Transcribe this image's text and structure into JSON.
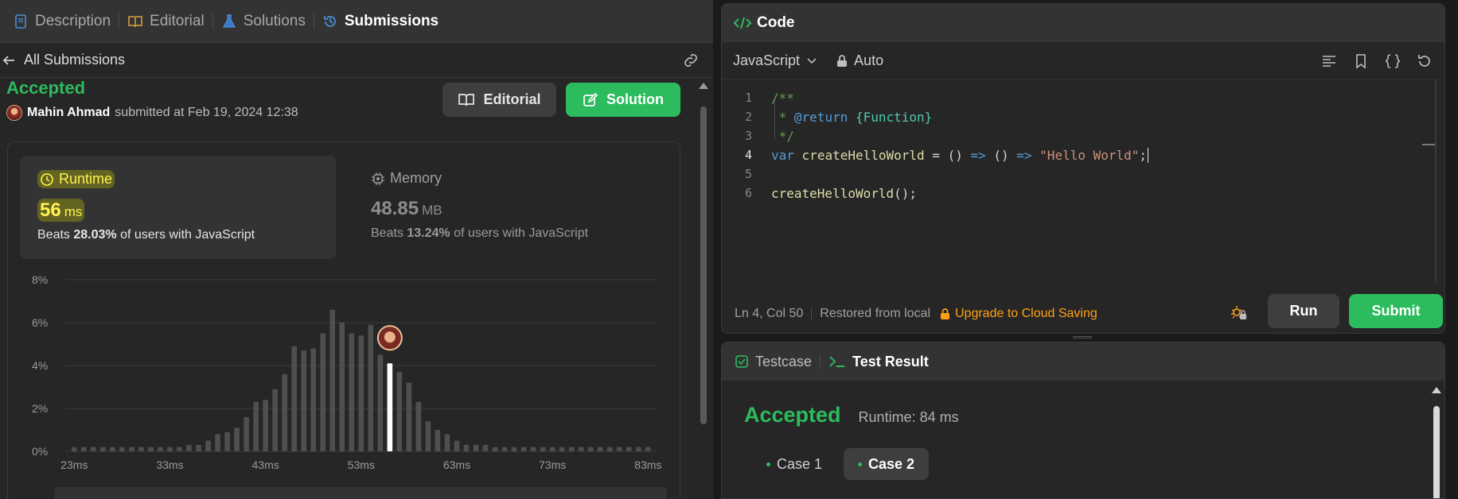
{
  "left_tabs": [
    {
      "label": "Description",
      "icon": "description-icon"
    },
    {
      "label": "Editorial",
      "icon": "book-icon"
    },
    {
      "label": "Solutions",
      "icon": "flask-icon"
    },
    {
      "label": "Submissions",
      "icon": "history-icon",
      "active": true
    }
  ],
  "subbar": {
    "back_label": "All Submissions"
  },
  "submission": {
    "status": "Accepted",
    "author": "Mahin Ahmad",
    "submitted_text": "submitted at Feb 19, 2024 12:38",
    "editorial_button": "Editorial",
    "solution_button": "Solution"
  },
  "runtime": {
    "label": "Runtime",
    "value": "56",
    "unit": "ms",
    "beats_prefix": "Beats",
    "beats_pct": "28.03%",
    "beats_suffix": "of users with JavaScript"
  },
  "memory": {
    "label": "Memory",
    "value": "48.85",
    "unit": "MB",
    "beats_prefix": "Beats",
    "beats_pct": "13.24%",
    "beats_suffix": "of users with JavaScript"
  },
  "chart_data": {
    "type": "bar",
    "y_ticks": [
      "8%",
      "6%",
      "4%",
      "2%",
      "0%"
    ],
    "ylim": [
      0,
      8
    ],
    "x_tick_labels": [
      "23ms",
      "33ms",
      "43ms",
      "53ms",
      "63ms",
      "73ms",
      "83ms"
    ],
    "x_start": 23,
    "x_step": 1,
    "values": [
      0.2,
      0.2,
      0.2,
      0.2,
      0.2,
      0.2,
      0.2,
      0.2,
      0.2,
      0.2,
      0.2,
      0.2,
      0.3,
      0.3,
      0.5,
      0.8,
      0.9,
      1.1,
      1.6,
      2.3,
      2.4,
      2.9,
      3.6,
      4.9,
      4.7,
      4.8,
      5.5,
      6.6,
      6.0,
      5.5,
      5.4,
      5.9,
      4.5,
      4.1,
      3.7,
      3.2,
      2.3,
      1.4,
      1.0,
      0.8,
      0.5,
      0.3,
      0.3,
      0.3,
      0.2,
      0.2,
      0.2,
      0.2,
      0.2,
      0.2,
      0.2,
      0.2,
      0.2,
      0.2,
      0.2,
      0.2,
      0.2,
      0.2,
      0.2,
      0.2,
      0.2
    ],
    "highlight_index": 33,
    "colors": {
      "bar": "#4f4f4f",
      "highlight": "#ffffff",
      "grid": "#3c3c3c"
    }
  },
  "code_panel": {
    "title": "Code",
    "language": "JavaScript",
    "auto_label": "Auto",
    "lines": [
      {
        "n": "1",
        "text": "/**"
      },
      {
        "n": "2",
        "text": " * @return {Function}"
      },
      {
        "n": "3",
        "text": " */"
      },
      {
        "n": "4",
        "text": "var createHelloWorld = () => () => \"Hello World\";"
      },
      {
        "n": "5",
        "text": ""
      },
      {
        "n": "6",
        "text": "createHelloWorld();"
      }
    ],
    "cursor": "Ln 4, Col 50",
    "restored": "Restored from local",
    "upgrade": "Upgrade to Cloud Saving",
    "run_label": "Run",
    "submit_label": "Submit"
  },
  "result_panel": {
    "tabs": [
      {
        "label": "Testcase",
        "icon": "checkbox-icon"
      },
      {
        "label": "Test Result",
        "icon": "terminal-icon",
        "active": true
      }
    ],
    "status": "Accepted",
    "runtime_text": "Runtime: 84 ms",
    "cases": [
      "Case 1",
      "Case 2"
    ],
    "active_case": 1
  }
}
